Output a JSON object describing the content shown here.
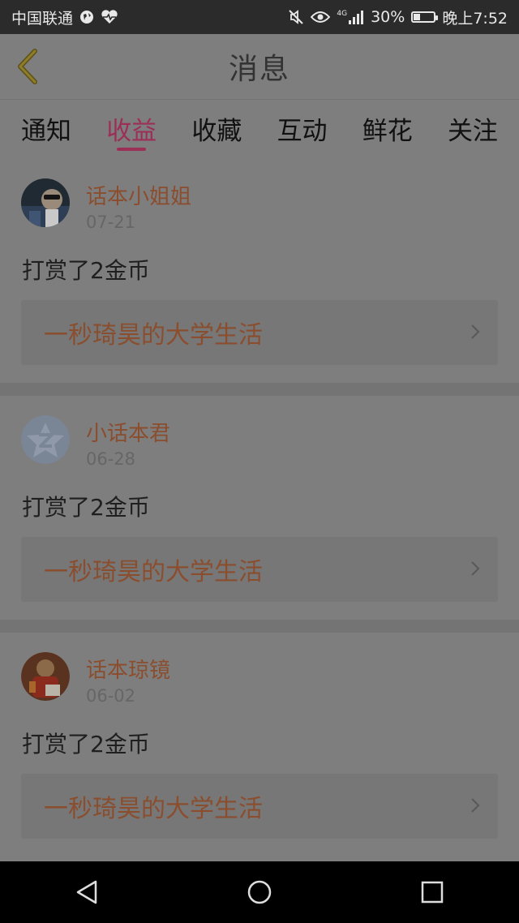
{
  "status_bar": {
    "carrier": "中国联通",
    "network": "4G",
    "battery": "30%",
    "time": "晚上7:52"
  },
  "header": {
    "title": "消息",
    "back_icon": "chevron-left-icon"
  },
  "tabs": [
    {
      "label": "通知",
      "active": false
    },
    {
      "label": "收益",
      "active": true
    },
    {
      "label": "收藏",
      "active": false
    },
    {
      "label": "互动",
      "active": false
    },
    {
      "label": "鲜花",
      "active": false
    },
    {
      "label": "关注",
      "active": false
    }
  ],
  "messages": [
    {
      "user": "话本小姐姐",
      "date": "07-21",
      "action": "打赏了2金币",
      "book": "一秒琦昊的大学生活"
    },
    {
      "user": "小话本君",
      "date": "06-28",
      "action": "打赏了2金币",
      "book": "一秒琦昊的大学生活"
    },
    {
      "user": "话本琼镜",
      "date": "06-02",
      "action": "打赏了2金币",
      "book": "一秒琦昊的大学生活"
    }
  ],
  "colors": {
    "accent": "#9b2f56",
    "username": "#8a4d2e",
    "overlay": "#7e7e7e"
  }
}
